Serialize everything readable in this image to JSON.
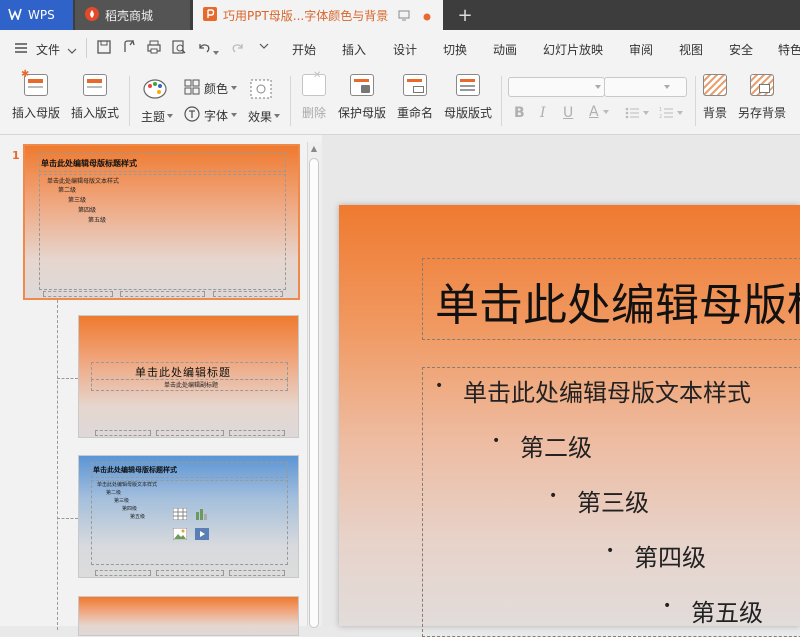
{
  "tabs": {
    "wps": "WPS",
    "store": "稻壳商城",
    "doc": "巧用PPT母版...字体颜色与背景"
  },
  "menu": {
    "file": "文件",
    "items": [
      "开始",
      "插入",
      "设计",
      "切换",
      "动画",
      "幻灯片放映",
      "审阅",
      "视图",
      "安全",
      "特色"
    ]
  },
  "ribbon": {
    "insert_master": "插入母版",
    "insert_layout": "插入版式",
    "theme": "主题",
    "color": "颜色",
    "font": "字体",
    "effect": "效果",
    "delete": "删除",
    "protect_master": "保护母版",
    "rename": "重命名",
    "master_layout": "母版版式",
    "bold": "B",
    "italic": "I",
    "underline": "U",
    "font_color": "A",
    "background": "背景",
    "save_background": "另存背景"
  },
  "thumbnails": {
    "number": "1",
    "master_title": "单击此处编辑母版标题样式",
    "master_text": "单击此处编辑母版文本样式",
    "levels": [
      "第二级",
      "第三级",
      "第四级",
      "第五级"
    ],
    "layout_title": "单击此处编辑标题",
    "layout_subtitle": "单击此处编辑副标题"
  },
  "slide": {
    "title": "单击此处编辑母版标题样式",
    "level1": "单击此处编辑母版文本样式",
    "level2": "第二级",
    "level3": "第三级",
    "level4": "第四级",
    "level5": "第五级"
  }
}
